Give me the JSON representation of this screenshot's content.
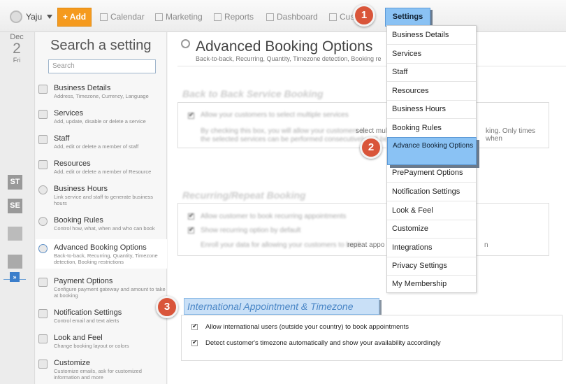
{
  "header": {
    "user_name": "Yaju",
    "add_label": "+ Add",
    "nav": [
      "Calendar",
      "Marketing",
      "Reports",
      "Dashboard",
      "Cus"
    ],
    "settings_label": "Settings"
  },
  "rail": {
    "month": "Dec",
    "day": "2",
    "weekday": "Fri",
    "badges": [
      "ST",
      "SE"
    ],
    "expand_label": "»"
  },
  "sidebar": {
    "title": "Search a setting",
    "search_placeholder": "Search",
    "items": [
      {
        "label": "Business Details",
        "sub": "Address, Timezone, Currency, Language"
      },
      {
        "label": "Services",
        "sub": "Add, update, disable or delete a service"
      },
      {
        "label": "Staff",
        "sub": "Add, edit or delete a member of staff"
      },
      {
        "label": "Resources",
        "sub": "Add, edit or delete a member of Resource"
      },
      {
        "label": "Business Hours",
        "sub": "Link service and staff to generate business hours"
      },
      {
        "label": "Booking Rules",
        "sub": "Control how, what, when and who can book"
      },
      {
        "label": "Advanced Booking Options",
        "sub": "Back-to-back, Recurring, Quantity, Timezone detection, Booking restrictions"
      },
      {
        "label": "Payment Options",
        "sub": "Configure payment gateway and amount to take at booking"
      },
      {
        "label": "Notification Settings",
        "sub": "Control email and text alerts"
      },
      {
        "label": "Look and Feel",
        "sub": "Change booking layout or colors"
      },
      {
        "label": "Customize",
        "sub": "Customize emails, ask for customized information and more"
      }
    ]
  },
  "main": {
    "title": "Advanced Booking Options",
    "subtitle": "Back-to-back, Recurring, Quantity, Timezone detection, Booking re",
    "section1": {
      "heading": "Back to Back Service Booking",
      "check": "Allow your customers to select multiple services",
      "desc_blur": "By checking this box, you will allow your customers to",
      "desc_clear": "select mult",
      "desc_clear2": "king. Only times when",
      "desc_blur2": "the selected services can be performed consecutively will be shown"
    },
    "section2": {
      "heading": "Recurring/Repeat Booking",
      "check1": "Allow customer to book recurring appointments",
      "check2": "Show recurring option by default",
      "desc_blur": "Enroll your data for allowing your customers to book",
      "desc_clear": "repeat appo",
      "desc_clear2": "n"
    },
    "section3": {
      "heading": "International Appointment & Timezone",
      "check1": "Allow international users (outside your country) to book appointments",
      "check2": "Detect customer's timezone automatically and show your availability accordingly"
    }
  },
  "dropdown": {
    "items": [
      "Business Details",
      "Services",
      "Staff",
      "Resources",
      "Business Hours",
      "Booking Rules",
      "Advance Booking Options",
      "PrePayment Options",
      "Notification Settings",
      "Look & Feel",
      "Customize",
      "Integrations",
      "Privacy Settings",
      "My Membership"
    ]
  },
  "steps": [
    "1",
    "2",
    "3"
  ]
}
